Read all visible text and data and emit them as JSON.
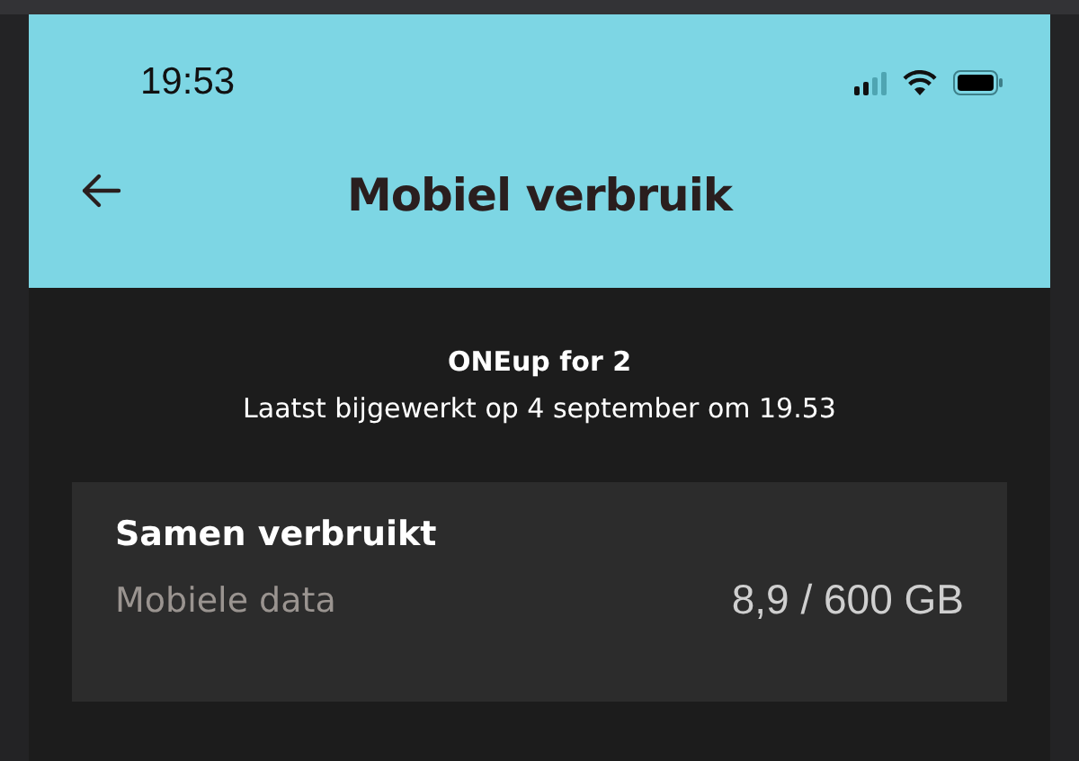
{
  "status_bar": {
    "time": "19:53"
  },
  "header": {
    "title": "Mobiel verbruik"
  },
  "plan": {
    "name": "ONEup for 2",
    "updated": "Laatst bijgewerkt op 4 september om 19.53"
  },
  "usage_card": {
    "title": "Samen verbruikt",
    "rows": [
      {
        "label": "Mobiele data",
        "value": "8,9 / 600 GB"
      }
    ]
  }
}
